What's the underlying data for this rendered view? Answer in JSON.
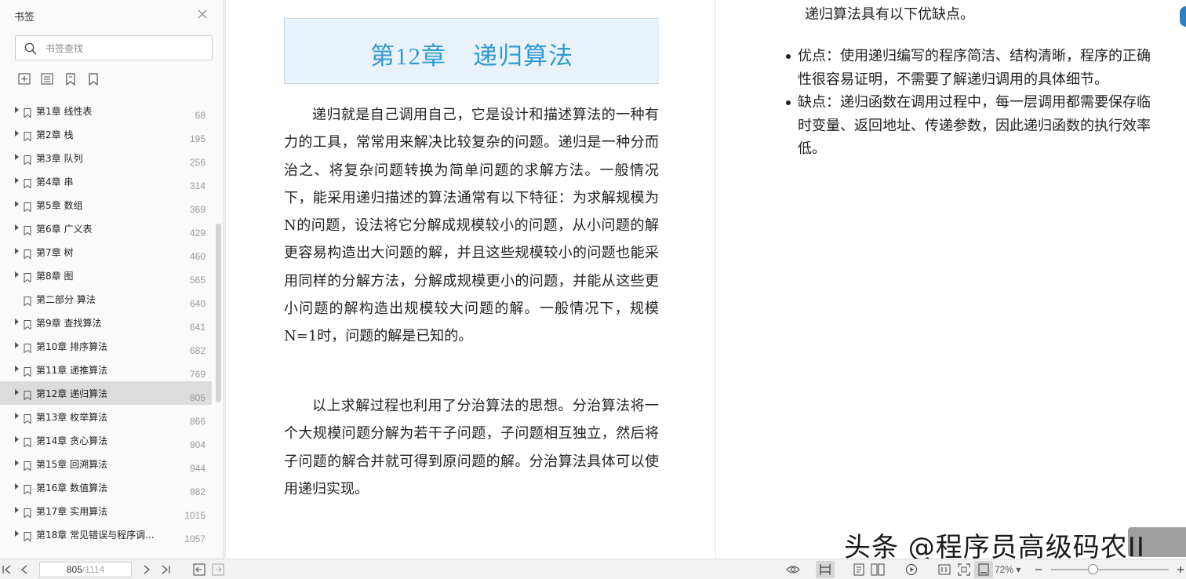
{
  "sidebar": {
    "title": "书签",
    "search_placeholder": "书签查找",
    "items": [
      {
        "label": "第1章 线性表",
        "page": "68",
        "arrow": true
      },
      {
        "label": "第2章 栈",
        "page": "195",
        "arrow": true
      },
      {
        "label": "第3章 队列",
        "page": "256",
        "arrow": true
      },
      {
        "label": "第4章 串",
        "page": "314",
        "arrow": true
      },
      {
        "label": "第5章 数组",
        "page": "369",
        "arrow": true
      },
      {
        "label": "第6章 广义表",
        "page": "429",
        "arrow": true
      },
      {
        "label": "第7章 树",
        "page": "460",
        "arrow": true
      },
      {
        "label": "第8章 图",
        "page": "565",
        "arrow": true
      },
      {
        "label": "第二部分 算法",
        "page": "640",
        "arrow": false
      },
      {
        "label": "第9章 查找算法",
        "page": "641",
        "arrow": true
      },
      {
        "label": "第10章 排序算法",
        "page": "682",
        "arrow": true
      },
      {
        "label": "第11章 递推算法",
        "page": "769",
        "arrow": true
      },
      {
        "label": "第12章 递归算法",
        "page": "805",
        "arrow": true,
        "active": true
      },
      {
        "label": "第13章 枚举算法",
        "page": "866",
        "arrow": true
      },
      {
        "label": "第14章 贪心算法",
        "page": "904",
        "arrow": true
      },
      {
        "label": "第15章 回溯算法",
        "page": "944",
        "arrow": true
      },
      {
        "label": "第16章 数值算法",
        "page": "982",
        "arrow": true
      },
      {
        "label": "第17章 实用算法",
        "page": "1015",
        "arrow": true
      },
      {
        "label": "第18章 常见错误与程序调...",
        "page": "1057",
        "arrow": true
      }
    ]
  },
  "document": {
    "chapter_num": "第12章",
    "chapter_name": "递归算法",
    "paragraph1": "递归就是自己调用自己，它是设计和描述算法的一种有力的工具，常常用来解决比较复杂的问题。递归是一种分而治之、将复杂问题转换为简单问题的求解方法。一般情况下，能采用递归描述的算法通常有以下特征：为求解规模为N的问题，设法将它分解成规模较小的问题，从小问题的解更容易构造出大问题的解，并且这些规模较小的问题也能采用同样的分解方法，分解成规模更小的问题，并能从这些更小问题的解构造出规模较大问题的解。一般情况下，规模N=1时，问题的解是已知的。",
    "paragraph2": "以上求解过程也利用了分治算法的思想。分治算法将一个大规模问题分解为若干子问题，子问题相互独立，然后将子问题的解合并就可得到原问题的解。分治算法具体可以使用递归实现。",
    "right_intro": "递归算法具有以下优缺点。",
    "right_bullets": [
      "优点：使用递归编写的程序简洁、结构清晰，程序的正确性很容易证明，不需要了解递归调用的具体细节。",
      "缺点：递归函数在调用过程中，每一层调用都需要保存临时变量、返回地址、传递参数，因此递归函数的执行效率低。"
    ]
  },
  "watermark": "头条 @程序员高级码农II",
  "statusbar": {
    "current_page": "805",
    "total_pages": "/1114",
    "zoom": "72%",
    "zoom_fraction": 0.35
  },
  "colors": {
    "chapter_title": "#2f9bd3",
    "chapter_bg": "#eaf2f9",
    "active_bookmark": "#dcdcdc"
  },
  "icons": [
    "close-icon",
    "search-icon",
    "add-bookmark-icon",
    "bookmark-list-icon",
    "bookmark-icon",
    "bookmark-outline-icon",
    "first-page-icon",
    "prev-page-icon",
    "next-page-icon",
    "last-page-icon",
    "back-icon",
    "forward-icon",
    "eye-icon",
    "single-page-icon",
    "double-page-icon",
    "play-icon",
    "actual-size-icon",
    "fit-page-icon",
    "fit-width-icon",
    "zoom-out-icon",
    "zoom-in-icon"
  ]
}
